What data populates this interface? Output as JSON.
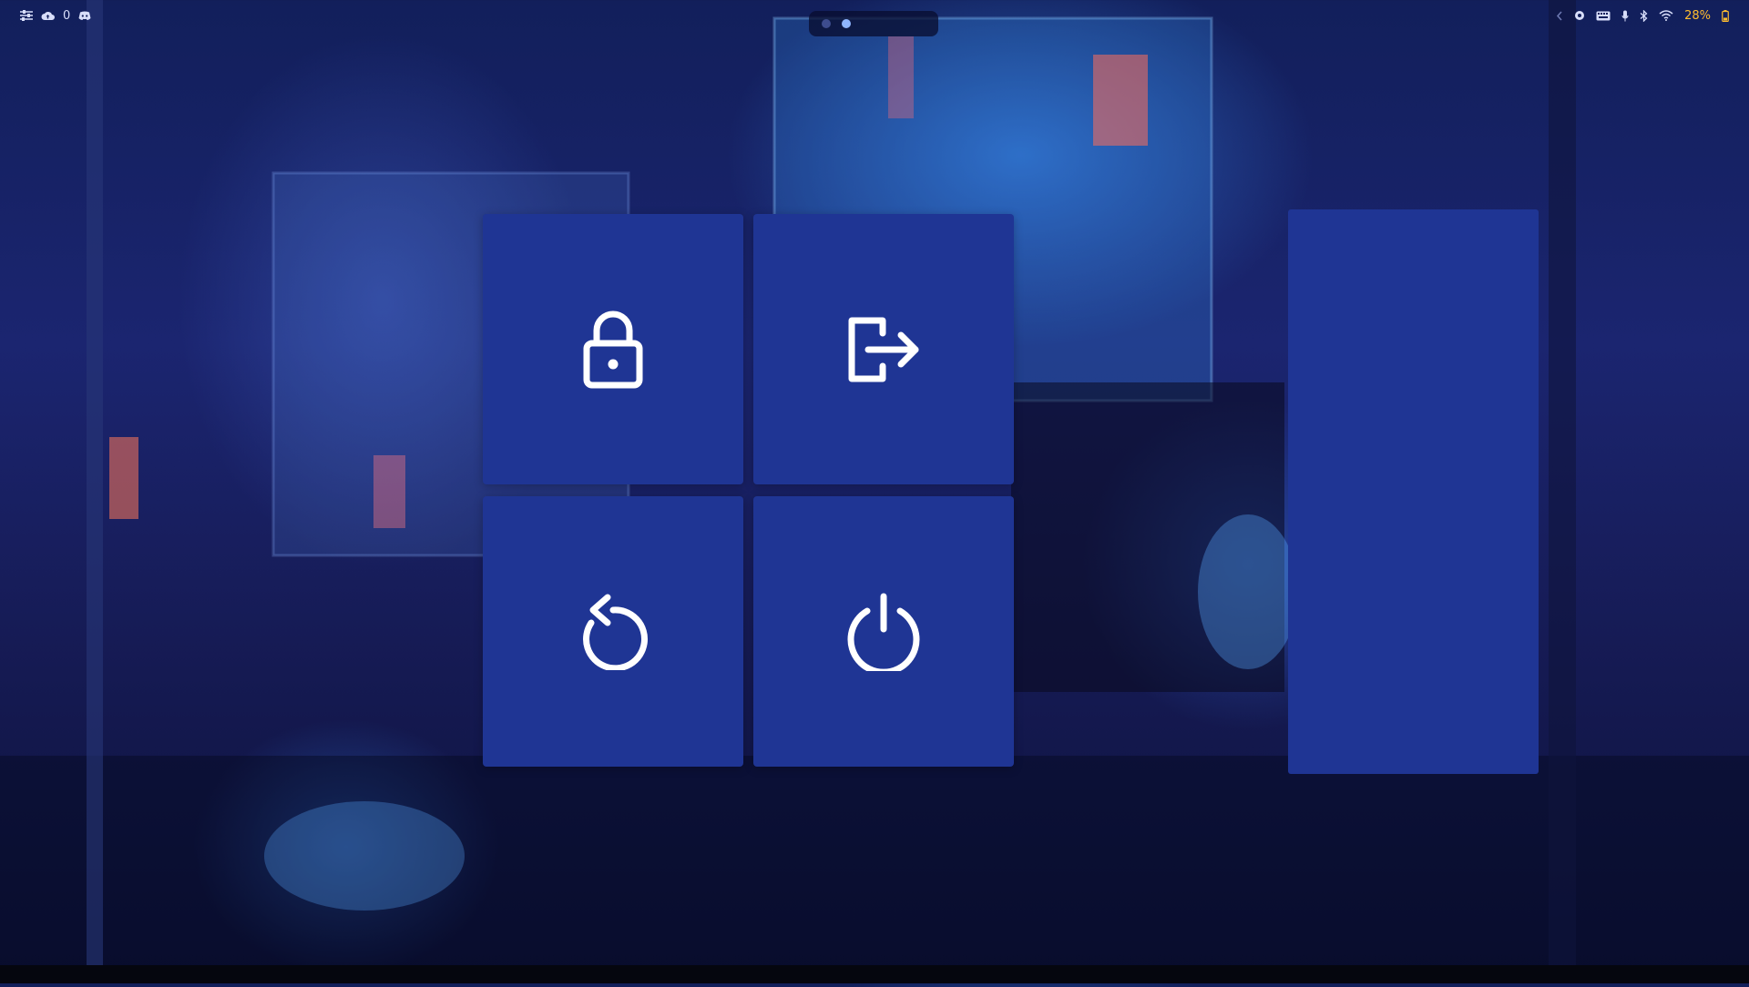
{
  "topbar": {
    "left": {
      "sliders_icon": "sliders-icon",
      "cloud_icon": "cloud-upload-icon",
      "cloud_count": "0",
      "discord_icon": "discord-icon"
    },
    "workspaces": [
      {
        "active": false
      },
      {
        "active": true
      }
    ],
    "right": {
      "chevron_icon": "chevron-left-icon",
      "battery_percent": "28%"
    }
  },
  "power_menu": {
    "buttons": [
      {
        "name": "lock",
        "icon": "lock-icon"
      },
      {
        "name": "logout",
        "icon": "logout-icon"
      },
      {
        "name": "reboot",
        "icon": "reboot-icon"
      },
      {
        "name": "shutdown",
        "icon": "power-icon"
      }
    ]
  },
  "colors": {
    "tile": "#1f3594",
    "battery": "#ffbd2e",
    "bar_text": "#d8defa"
  }
}
